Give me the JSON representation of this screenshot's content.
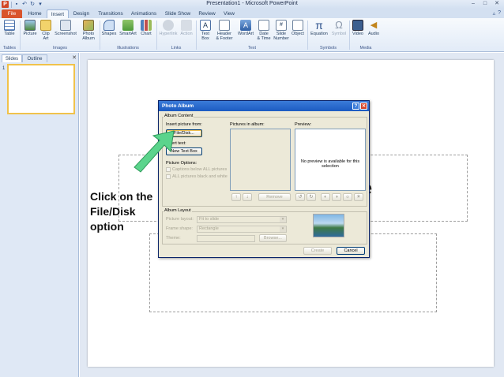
{
  "window": {
    "title": "Presentation1 - Microsoft PowerPoint",
    "app_icon_letter": "P"
  },
  "quick_access": {
    "icons": [
      "save-icon",
      "undo-icon",
      "redo-icon",
      "customize-icon"
    ]
  },
  "tabs": [
    {
      "label": "File"
    },
    {
      "label": "Home"
    },
    {
      "label": "Insert"
    },
    {
      "label": "Design"
    },
    {
      "label": "Transitions"
    },
    {
      "label": "Animations"
    },
    {
      "label": "Slide Show"
    },
    {
      "label": "Review"
    },
    {
      "label": "View"
    }
  ],
  "ribbon": {
    "buttons": {
      "table": "Table",
      "picture": "Picture",
      "clip_art_1": "Clip",
      "clip_art_2": "Art",
      "screenshot": "Screenshot",
      "photo_album_1": "Photo",
      "photo_album_2": "Album",
      "shapes": "Shapes",
      "smartart": "SmartArt",
      "chart": "Chart",
      "hyperlink": "Hyperlink",
      "action": "Action",
      "text_box_1": "Text",
      "text_box_2": "Box",
      "header_footer_1": "Header",
      "header_footer_2": "& Footer",
      "wordart": "WordArt",
      "date_time_1": "Date",
      "date_time_2": "& Time",
      "slide_number_1": "Slide",
      "slide_number_2": "Number",
      "object": "Object",
      "equation": "Equation",
      "symbol": "Symbol",
      "video": "Video",
      "audio": "Audio"
    },
    "groups": {
      "tables": "Tables",
      "images": "Images",
      "illustrations": "Illustrations",
      "links": "Links",
      "text": "Text",
      "symbols": "Symbols",
      "media": "Media"
    }
  },
  "left_pane": {
    "tabs": [
      "Slides",
      "Outline"
    ],
    "slide_number": "1"
  },
  "slide": {
    "title_ghost": "e"
  },
  "caption": {
    "line1": "Click on the",
    "line2": "File/Disk",
    "line3": "option"
  },
  "dialog": {
    "title": "Photo Album",
    "album_content": "Album Content",
    "insert_picture_from": "Insert picture from:",
    "file_disk_button": "File/Disk...",
    "insert_text": "Insert text:",
    "new_text_box_button": "New Text Box",
    "picture_options": "Picture Options:",
    "captions_below": "Captions below ALL pictures",
    "all_black_white": "ALL pictures black and white",
    "pictures_in_album": "Pictures in album:",
    "preview_label": "Preview:",
    "preview_message": "No preview is available for this selection",
    "up_button": "↑",
    "down_button": "↓",
    "remove_button": "Remove",
    "album_layout": "Album Layout",
    "picture_layout_label": "Picture layout:",
    "picture_layout_value": "Fit to slide",
    "frame_shape_label": "Frame shape:",
    "frame_shape_value": "Rectangle",
    "theme_label": "Theme:",
    "browse_button": "Browse...",
    "create_button": "Create",
    "cancel_button": "Cancel"
  },
  "colors": {
    "file_tab": "#d9542c",
    "dialog_titlebar": "#1c5bc2",
    "arrow": "#5bd48c",
    "selected_thumb_border": "#f0c24b"
  }
}
